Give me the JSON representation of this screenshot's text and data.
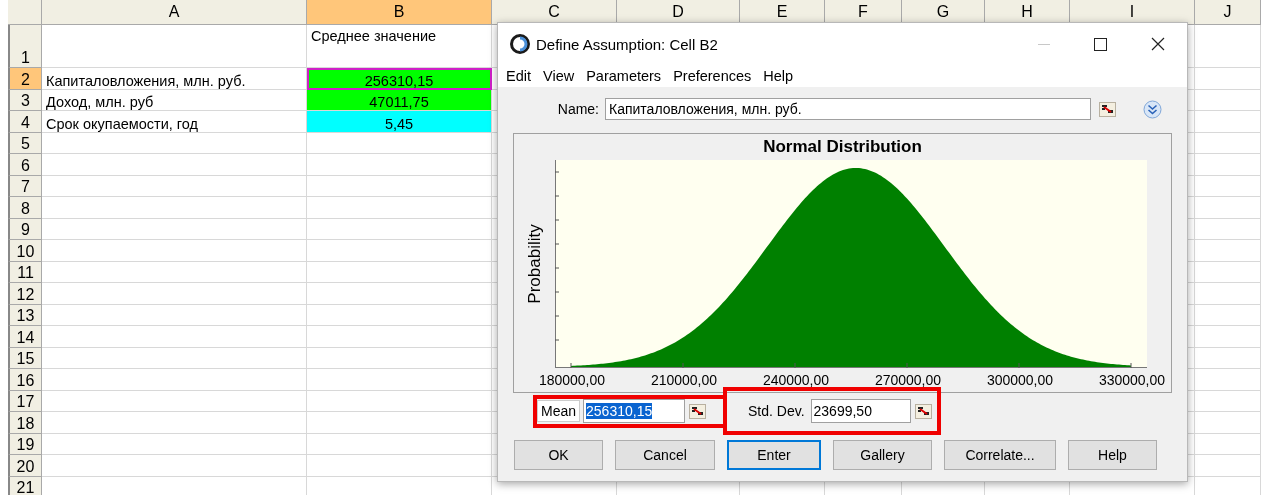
{
  "sheet": {
    "columns": [
      {
        "label": "A",
        "selected": false
      },
      {
        "label": "B",
        "selected": true
      },
      {
        "label": "C",
        "selected": false
      },
      {
        "label": "D",
        "selected": false
      },
      {
        "label": "E",
        "selected": false
      },
      {
        "label": "F",
        "selected": false
      },
      {
        "label": "G",
        "selected": false
      },
      {
        "label": "H",
        "selected": false
      },
      {
        "label": "I",
        "selected": false
      },
      {
        "label": "J",
        "selected": false
      }
    ],
    "rows": [
      {
        "number": "1",
        "selected": false,
        "b": {
          "text": "Среднее значение"
        }
      },
      {
        "number": "2",
        "selected": true,
        "a": {
          "text": "Капиталовложения, млн. руб."
        },
        "b": {
          "text": "256310,15",
          "color": "#00ff00",
          "active": true
        }
      },
      {
        "number": "3",
        "selected": false,
        "a": {
          "text": "Доход, млн. руб"
        },
        "b": {
          "text": "47011,75",
          "color": "#00ff00",
          "active": false
        }
      },
      {
        "number": "4",
        "selected": false,
        "a": {
          "text": "Срок окупаемости, год"
        },
        "b": {
          "text": "5,45",
          "color": "#00ffff",
          "active": false
        }
      },
      {
        "number": "5",
        "selected": false
      },
      {
        "number": "6",
        "selected": false
      },
      {
        "number": "7",
        "selected": false
      },
      {
        "number": "8",
        "selected": false
      },
      {
        "number": "9",
        "selected": false
      },
      {
        "number": "10",
        "selected": false
      },
      {
        "number": "11",
        "selected": false
      },
      {
        "number": "12",
        "selected": false
      },
      {
        "number": "13",
        "selected": false
      },
      {
        "number": "14",
        "selected": false
      },
      {
        "number": "15",
        "selected": false
      },
      {
        "number": "16",
        "selected": false
      },
      {
        "number": "17",
        "selected": false
      },
      {
        "number": "18",
        "selected": false
      },
      {
        "number": "19",
        "selected": false
      },
      {
        "number": "20",
        "selected": false
      },
      {
        "number": "21",
        "selected": false
      }
    ]
  },
  "dialog": {
    "title": "Define Assumption: Cell B2",
    "menu": [
      "Edit",
      "View",
      "Parameters",
      "Preferences",
      "Help"
    ],
    "name": {
      "label": "Name:",
      "value": "Капиталовложения, млн. руб."
    },
    "chart": {
      "title": "Normal Distribution",
      "ylabel": "Probability",
      "x_tick_labels": [
        "180000,00",
        "210000,00",
        "240000,00",
        "270000,00",
        "300000,00",
        "330000,00"
      ]
    },
    "parameters": [
      {
        "kind": "boxed",
        "label": "Mean",
        "value": "256310,15",
        "text_selected": true,
        "highlighted": true
      },
      {
        "kind": "plain",
        "label": "Std. Dev.",
        "value": "23699,50",
        "text_selected": false,
        "highlighted": true
      }
    ],
    "buttons": [
      {
        "label": "OK",
        "focused": false
      },
      {
        "label": "Cancel",
        "focused": false
      },
      {
        "label": "Enter",
        "focused": true
      },
      {
        "label": "Gallery",
        "focused": false
      },
      {
        "label": "Correlate...",
        "focused": false
      },
      {
        "label": "Help",
        "focused": false
      }
    ]
  }
}
